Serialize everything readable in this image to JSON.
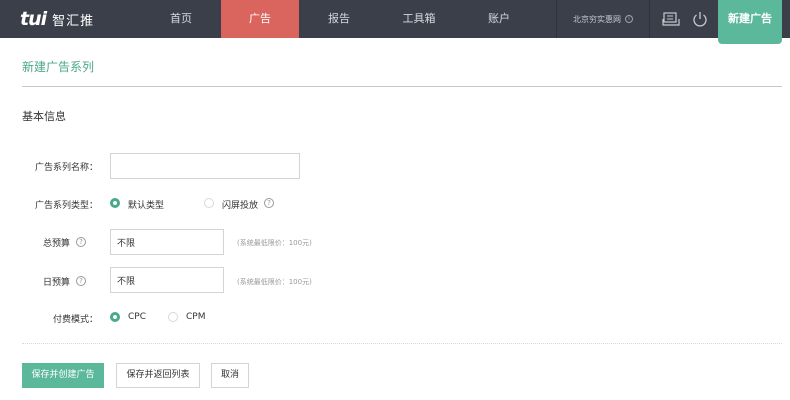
{
  "header": {
    "logo_mark": "tui",
    "logo_text": "智汇推",
    "nav": [
      {
        "label": "首页"
      },
      {
        "label": "广告",
        "active": true
      },
      {
        "label": "报告"
      },
      {
        "label": "工具箱"
      },
      {
        "label": "账户"
      }
    ],
    "account_name": "北京穷实惠网",
    "account_info_icon": "i",
    "new_ad_button": "新建广告",
    "icons": [
      "inbox-icon",
      "power-icon"
    ]
  },
  "page": {
    "title": "新建广告系列",
    "section_title": "基本信息"
  },
  "form": {
    "series_name": {
      "label": "广告系列名称：",
      "value": "",
      "placeholder": ""
    },
    "series_type": {
      "label": "广告系列类型：",
      "options": [
        {
          "label": "默认类型",
          "checked": true
        },
        {
          "label": "闪屏投放",
          "checked": false
        }
      ],
      "help": "?"
    },
    "total_budget": {
      "label": "总预算",
      "help": "?",
      "value": "不限",
      "hint": "(系统最低限价：100元)"
    },
    "daily_budget": {
      "label": "日预算",
      "help": "?",
      "value": "不限",
      "hint": "(系统最低限价：100元)"
    },
    "billing_mode": {
      "label": "付费模式：",
      "options": [
        {
          "label": "CPC",
          "checked": true
        },
        {
          "label": "CPM",
          "checked": false
        }
      ]
    }
  },
  "actions": {
    "save_create": "保存并创建广告",
    "save_return": "保存并返回列表",
    "cancel": "取消"
  },
  "colors": {
    "topbar": "#3b3f4a",
    "nav_active": "#d9655e",
    "accent": "#5bb89a",
    "title": "#4aa88b"
  }
}
